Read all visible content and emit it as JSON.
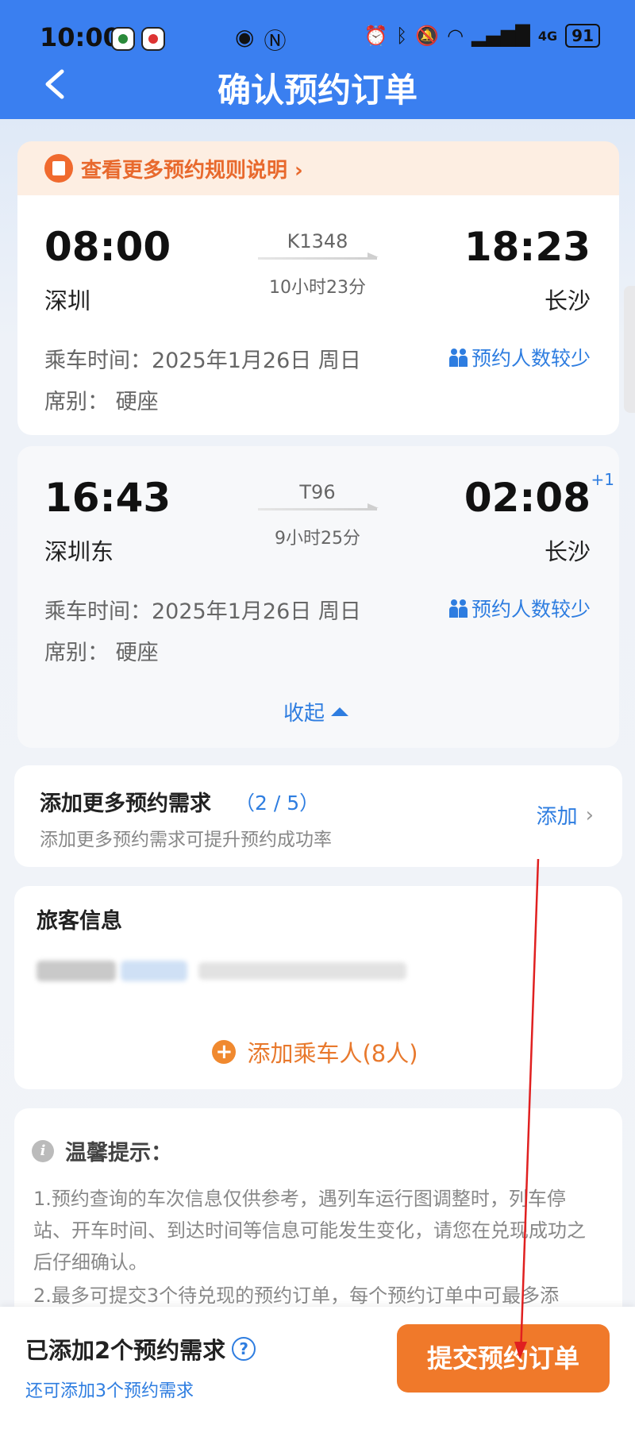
{
  "status_bar": {
    "time": "10:00",
    "battery": "91",
    "network": "4G"
  },
  "header": {
    "title": "确认预约订单"
  },
  "rules_banner": {
    "text": "查看更多预约规则说明 ›"
  },
  "trains": [
    {
      "depart_time": "08:00",
      "depart_station": "深圳",
      "train_no": "K1348",
      "duration": "10小时23分",
      "arrive_time": "18:23",
      "arrive_station": "长沙",
      "day_offset": "",
      "ride_date": "乘车时间：2025年1月26日 周日",
      "seat": "席别：  硬座",
      "demand_hint": "预约人数较少"
    },
    {
      "depart_time": "16:43",
      "depart_station": "深圳东",
      "train_no": "T96",
      "duration": "9小时25分",
      "arrive_time": "02:08",
      "arrive_station": "长沙",
      "day_offset": "+1",
      "ride_date": "乘车时间：2025年1月26日 周日",
      "seat": "席别：  硬座",
      "demand_hint": "预约人数较少"
    }
  ],
  "collapse_label": "收起",
  "more_demands": {
    "title": "添加更多预约需求",
    "count": "（2 / 5）",
    "subtitle": "添加更多预约需求可提升预约成功率",
    "add_label": "添加"
  },
  "passengers": {
    "title": "旅客信息",
    "add_label": "添加乘车人(8人)"
  },
  "tips": {
    "title": "温馨提示：",
    "paragraph_1": "1.预约查询的车次信息仅供参考，遇列车运行图调整时，列车停站、开车时间、到达时间等信息可能发生变化，请您在兑现成功之后仔细确认。",
    "paragraph_2": "2.最多可提交3个待兑现的预约订单，每个预约订单中可最多添"
  },
  "footer": {
    "added_text": "已添加2个预约需求",
    "remaining_text": "还可添加3个预约需求",
    "submit_label": "提交预约订单"
  },
  "colors": {
    "header_blue": "#3a7ff0",
    "link_blue": "#2e7de0",
    "accent_orange": "#f0792a",
    "annotation_red": "#e02020"
  }
}
